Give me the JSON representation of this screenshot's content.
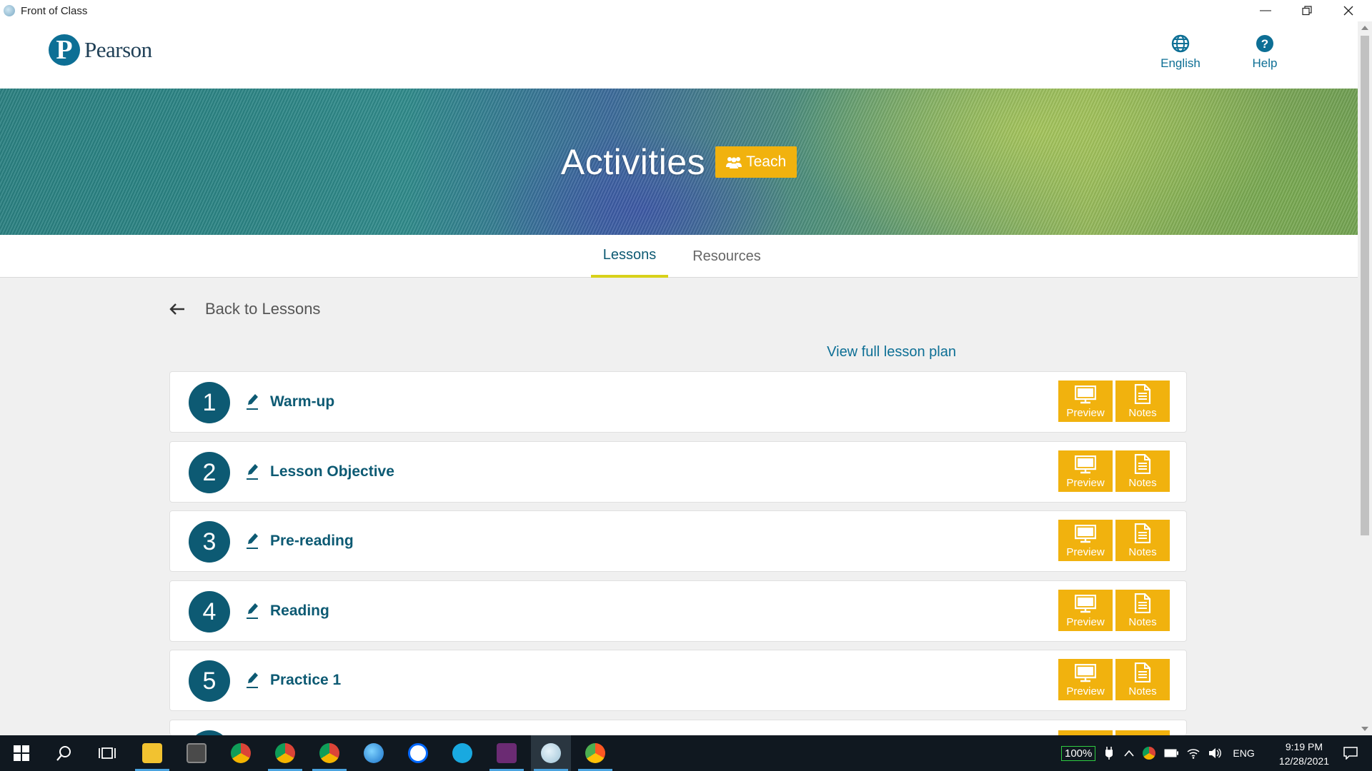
{
  "window": {
    "title": "Front of Class"
  },
  "header": {
    "brand": "Pearson",
    "logo_letter": "P",
    "language_label": "English",
    "help_label": "Help"
  },
  "hero": {
    "title": "Activities",
    "teach_label": "Teach"
  },
  "tabs": [
    {
      "label": "Lessons",
      "active": true
    },
    {
      "label": "Resources",
      "active": false
    }
  ],
  "content": {
    "back_label": "Back to Lessons",
    "full_plan_label": "View full lesson plan",
    "lessons": [
      {
        "number": "1",
        "name": "Warm-up",
        "preview_label": "Preview",
        "notes_label": "Notes"
      },
      {
        "number": "2",
        "name": "Lesson Objective",
        "preview_label": "Preview",
        "notes_label": "Notes"
      },
      {
        "number": "3",
        "name": "Pre-reading",
        "preview_label": "Preview",
        "notes_label": "Notes"
      },
      {
        "number": "4",
        "name": "Reading",
        "preview_label": "Preview",
        "notes_label": "Notes"
      },
      {
        "number": "5",
        "name": "Practice 1",
        "preview_label": "Preview",
        "notes_label": "Notes"
      }
    ]
  },
  "taskbar": {
    "battery_percent": "100%",
    "input_language": "ENG",
    "time": "9:19 PM",
    "date": "12/28/2021"
  },
  "colors": {
    "brand_teal": "#0d6f95",
    "lesson_navy": "#0d5a73",
    "accent_orange": "#f1b20e",
    "tab_underline": "#d8d11a"
  }
}
